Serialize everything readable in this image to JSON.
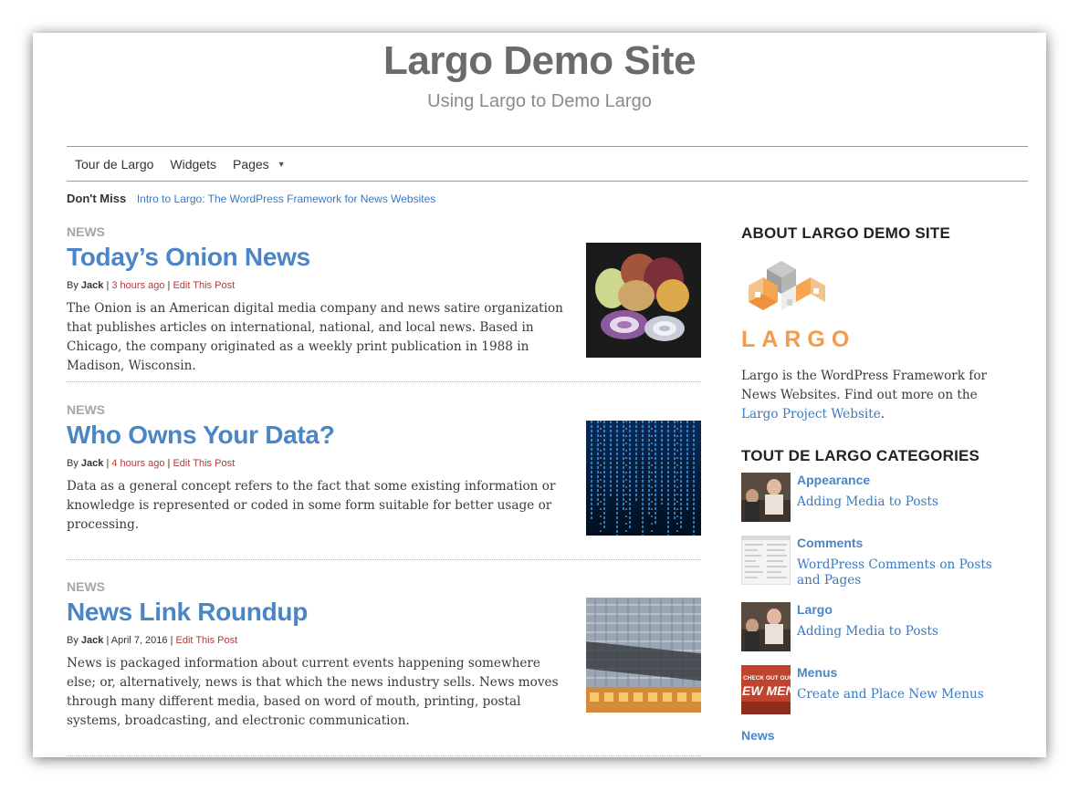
{
  "site": {
    "title": "Largo Demo Site",
    "tagline": "Using Largo to Demo Largo"
  },
  "nav": {
    "items": [
      "Tour de Largo",
      "Widgets",
      "Pages"
    ]
  },
  "dont_miss": {
    "label": "Don't Miss",
    "link": "Intro to Largo: The WordPress Framework for News Websites"
  },
  "posts": [
    {
      "category": "NEWS",
      "title": "Today’s Onion News",
      "by": "By",
      "author": "Jack",
      "time": "3 hours ago",
      "edit": "Edit This Post",
      "excerpt": "The Onion is an American digital media company and news satire organization that publishes articles on international, national, and local news. Based in Chicago, the company originated as a weekly print publication in 1988 in Madison, Wisconsin."
    },
    {
      "category": "NEWS",
      "title": "Who Owns Your Data?",
      "by": "By",
      "author": "Jack",
      "time": "4 hours ago",
      "edit": "Edit This Post",
      "excerpt": "Data as a general concept refers to the fact that some existing information or knowledge is represented or coded in some form suitable for better usage or processing."
    },
    {
      "category": "NEWS",
      "title": "News Link Roundup",
      "by": "By",
      "author": "Jack",
      "time": "April 7, 2016",
      "edit": "Edit This Post",
      "excerpt": "News is packaged information about current events happening somewhere else; or, alternatively, news is that which the news industry sells. News moves through many different media, based on word of mouth, printing, postal systems, broadcasting, and electronic communication."
    }
  ],
  "sidebar": {
    "about": {
      "title": "ABOUT LARGO DEMO SITE",
      "logo_text": "LARGO",
      "text_before": "Largo is the WordPress Framework for News Websites. Find out more on the ",
      "link": "Largo Project Website",
      "text_after": "."
    },
    "categories": {
      "title": "TOUT DE LARGO CATEGORIES",
      "items": [
        {
          "name": "Appearance",
          "post": "Adding Media to Posts"
        },
        {
          "name": "Comments",
          "post": "WordPress Comments on Posts and Pages"
        },
        {
          "name": "Largo",
          "post": "Adding Media to Posts"
        },
        {
          "name": "Menus",
          "post": "Create and Place New Menus",
          "thumb_text": "CHECK OUT OUR NEW MENUS"
        },
        {
          "name": "News"
        }
      ]
    }
  },
  "colors": {
    "link": "#3a79bf",
    "title_link": "#4a86c5",
    "edit_red": "#b23a3a",
    "logo_orange": "#f39a4c"
  }
}
